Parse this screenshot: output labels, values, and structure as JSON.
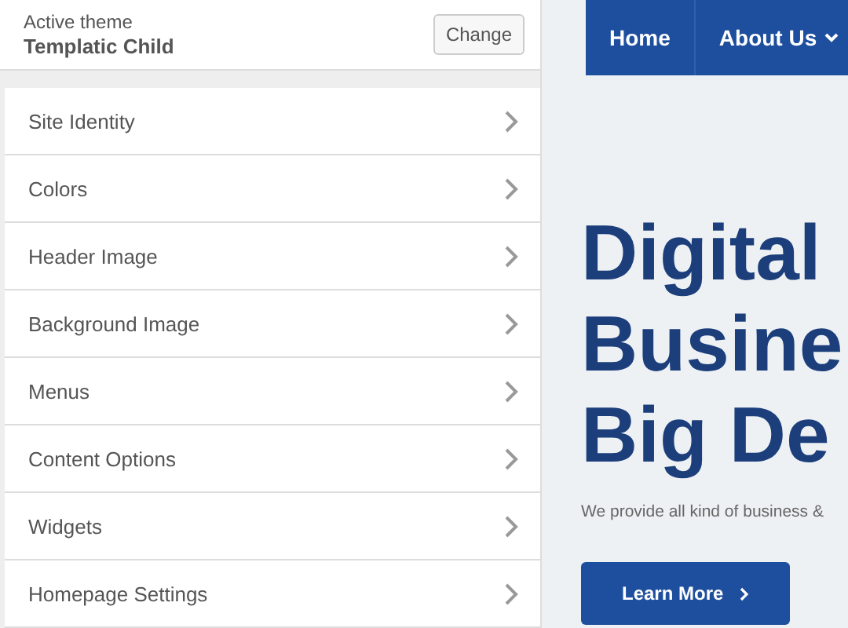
{
  "theme": {
    "caption": "Active theme",
    "name": "Templatic Child",
    "button": "Change"
  },
  "sections": [
    {
      "label": "Site Identity"
    },
    {
      "label": "Colors"
    },
    {
      "label": "Header Image"
    },
    {
      "label": "Background Image"
    },
    {
      "label": "Menus"
    },
    {
      "label": "Content Options"
    },
    {
      "label": "Widgets"
    },
    {
      "label": "Homepage Settings"
    }
  ],
  "preview": {
    "nav": [
      {
        "label": "Home",
        "dropdown": false
      },
      {
        "label": "About Us",
        "dropdown": true
      }
    ],
    "heading": [
      "Digital",
      "Busine",
      "Big De"
    ],
    "tagline": "We provide all kind of business &",
    "button": "Learn More"
  }
}
